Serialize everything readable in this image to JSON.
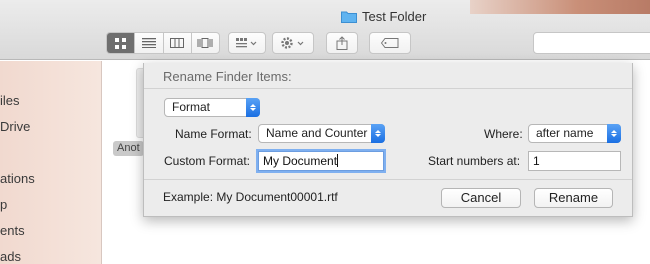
{
  "window": {
    "title": "Test Folder"
  },
  "toolbar": {
    "view_modes": [
      "icon-view",
      "list-view",
      "column-view",
      "cover-flow-view"
    ],
    "active_view": "icon-view"
  },
  "sidebar": {
    "items": [
      {
        "label": "iles"
      },
      {
        "label": "Drive"
      },
      {
        "label": ""
      },
      {
        "label": "ations"
      },
      {
        "label": "p"
      },
      {
        "label": "ents"
      },
      {
        "label": "ads"
      }
    ]
  },
  "content": {
    "file_label": "Anot"
  },
  "dialog": {
    "title": "Rename Finder Items:",
    "mode_select": "Format",
    "name_format_label": "Name Format:",
    "name_format_value": "Name and Counter",
    "where_label": "Where:",
    "where_value": "after name",
    "custom_format_label": "Custom Format:",
    "custom_format_value": "My Document",
    "start_numbers_label": "Start numbers at:",
    "start_numbers_value": "1",
    "example_text": "Example: My Document00001.rtf",
    "cancel_label": "Cancel",
    "rename_label": "Rename"
  },
  "colors": {
    "accent": "#1a6fe3",
    "focus_ring": "#7fb0f0",
    "sidebar_bg": "#f3ded5"
  }
}
